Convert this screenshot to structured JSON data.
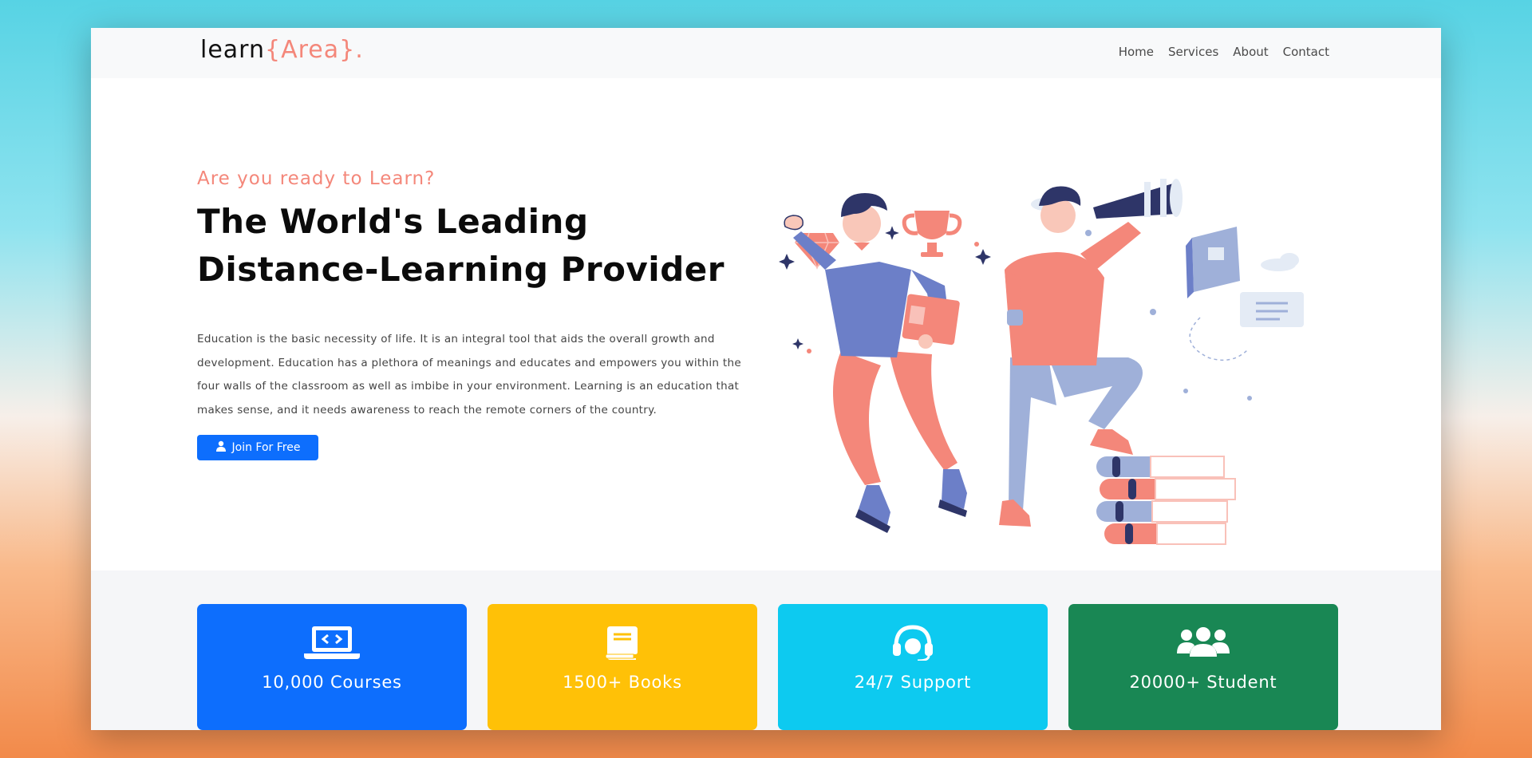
{
  "brand": {
    "prefix": "learn",
    "accent": "{Area}."
  },
  "nav": {
    "items": [
      "Home",
      "Services",
      "About",
      "Contact"
    ]
  },
  "hero": {
    "tagline": "Are you ready to Learn?",
    "headline_line1": "The World's Leading",
    "headline_line2": "Distance-Learning Provider",
    "description": "Education is the basic necessity of life. It is an integral tool that aids the overall growth and development. Education has a plethora of meanings and educates and empowers you within the four walls of the classroom as well as imbibe in your environment. Learning is an education that makes sense, and it needs awareness to reach the remote corners of the country.",
    "cta_label": "Join For Free",
    "cta_icon": "user-icon"
  },
  "stats": [
    {
      "label": "10,000 Courses",
      "icon": "laptop-code-icon",
      "color": "#0d6efd"
    },
    {
      "label": "1500+ Books",
      "icon": "book-icon",
      "color": "#ffc107"
    },
    {
      "label": "24/7 Support",
      "icon": "headset-icon",
      "color": "#0dcaf0"
    },
    {
      "label": "20000+ Student",
      "icon": "users-icon",
      "color": "#198754"
    }
  ],
  "colors": {
    "accent": "#f4877a",
    "primary": "#0d6efd",
    "illustration_blue": "#6c7fc8",
    "illustration_navy": "#2e3568"
  }
}
